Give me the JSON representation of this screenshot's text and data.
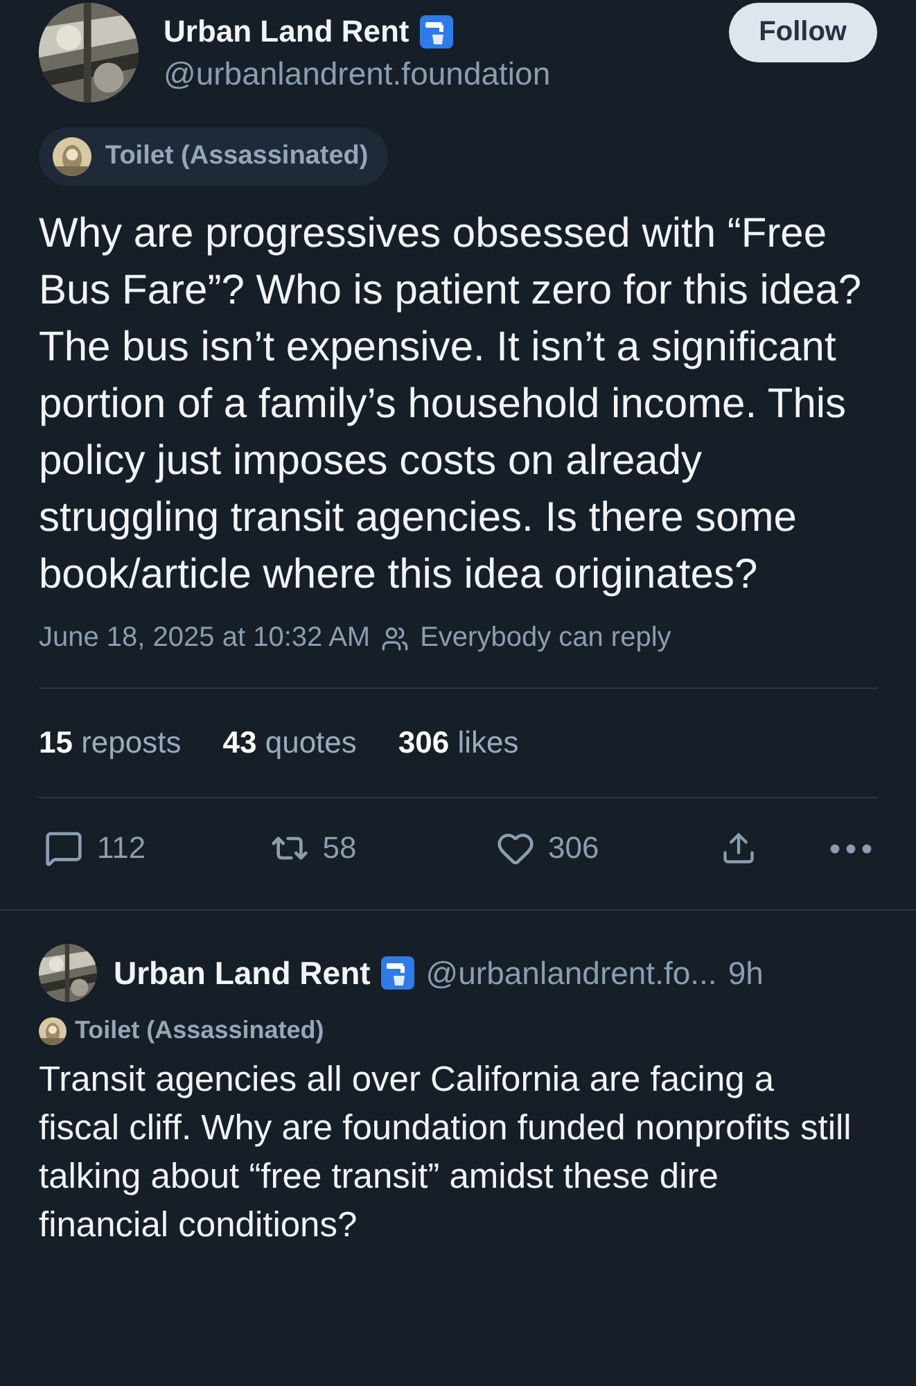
{
  "post": {
    "author": {
      "name": "Urban Land Rent",
      "handle": "@urbanlandrent.foundation"
    },
    "follow_button": "Follow",
    "label": "Toilet (Assassinated)",
    "text": "Why are progressives obsessed with “Free Bus Fare”? Who is patient zero for this idea? The bus isn’t expensive. It isn’t a significant portion of a family’s household income. This policy just imposes costs on already struggling transit agencies. Is there some book/article where this idea originates?",
    "timestamp": "June 18, 2025 at 10:32 AM",
    "reply_setting": "Everybody can reply",
    "stats": [
      "**15** reposts",
      "**43** quotes",
      "**306** likes"
    ],
    "actions": [
      {
        "kind": "reply",
        "count": "112"
      },
      {
        "kind": "repost",
        "count": "58"
      },
      {
        "kind": "like",
        "count": "306"
      },
      {
        "kind": "share"
      },
      {
        "kind": "more"
      }
    ]
  },
  "reply": {
    "name": "Urban Land Rent",
    "handle": "@urbanlandrent.fo...",
    "time": "9h",
    "label": "Toilet (Assassinated)",
    "text": "Transit agencies all over California are facing a fiscal cliff. Why are foundation funded nonprofits still talking about “free transit” amidst these dire financial conditions?"
  }
}
